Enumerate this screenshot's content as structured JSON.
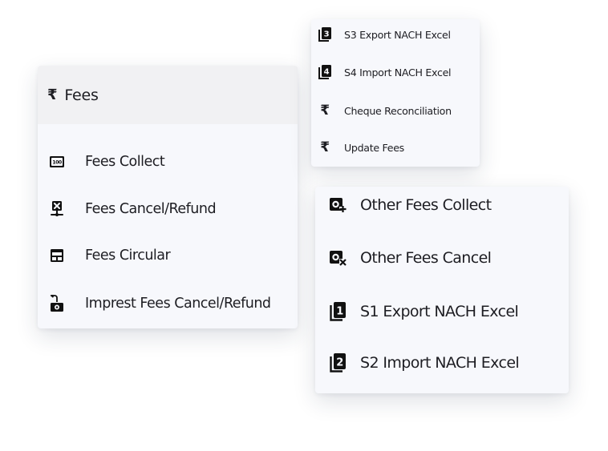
{
  "fees_menu": {
    "header": {
      "icon": "rupee-icon",
      "label": "Fees"
    },
    "items": [
      {
        "label": "Fees Collect",
        "icon": "banknote-100-icon"
      },
      {
        "label": "Fees Cancel/Refund",
        "icon": "cancel-receipt-icon"
      },
      {
        "label": "Fees Circular",
        "icon": "circular-table-icon"
      },
      {
        "label": "Imprest Fees Cancel/Refund",
        "icon": "undo-box-icon"
      }
    ]
  },
  "nach_menu_top": {
    "items": [
      {
        "label": "S3 Export NACH Excel",
        "icon": "book-3-icon",
        "badge": "3"
      },
      {
        "label": "S4 Import NACH Excel",
        "icon": "book-4-icon",
        "badge": "4"
      },
      {
        "label": "Cheque Reconciliation",
        "icon": "rupee-icon",
        "glyph": "₹"
      },
      {
        "label": "Update Fees",
        "icon": "rupee-icon",
        "glyph": "₹"
      }
    ]
  },
  "other_menu": {
    "items": [
      {
        "label": "Other Fees Collect",
        "icon": "coin-plus-icon"
      },
      {
        "label": "Other Fees Cancel",
        "icon": "coin-x-icon"
      },
      {
        "label": "S1 Export NACH Excel",
        "icon": "book-1-icon",
        "badge": "1"
      },
      {
        "label": "S2 Import NACH Excel",
        "icon": "book-2-icon",
        "badge": "2"
      }
    ]
  },
  "colors": {
    "panel_bg": "#f7f8fc",
    "header_bg": "#f1f1f3",
    "text": "#1d1d22",
    "icon": "#111111"
  }
}
